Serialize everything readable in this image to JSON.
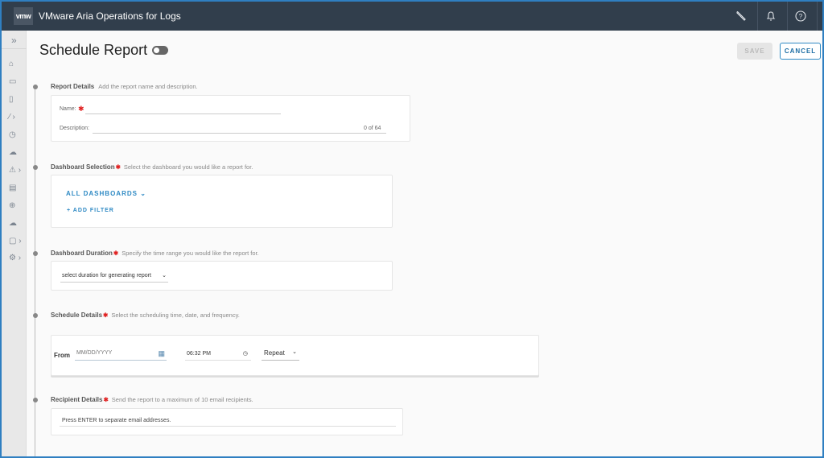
{
  "header": {
    "logo": "vmw",
    "title": "VMware Aria Operations for Logs",
    "icons": [
      "wrench-icon",
      "bell-icon",
      "help-icon"
    ]
  },
  "sidebar": {
    "expand": "»",
    "items": [
      "home-icon",
      "dashboards-icon",
      "explore-logs-icon",
      "tools-icon",
      "gauge-icon",
      "cloud-icon",
      "alerts-icon",
      "clipboard-icon",
      "integrations-icon",
      "cloud-sync-icon",
      "reports-icon",
      "settings-icon"
    ]
  },
  "page": {
    "title": "Schedule Report",
    "save": "SAVE",
    "cancel": "CANCEL"
  },
  "report_details": {
    "title": "Report Details",
    "hint": "Add the report name and description.",
    "name_label": "Name:",
    "req": "✱",
    "desc_label": "Description:",
    "counter": "0 of 64"
  },
  "dashboard_selection": {
    "title": "Dashboard Selection",
    "req": "✱",
    "hint": "Select the dashboard you would like a report for.",
    "all": "ALL DASHBOARDS ⌄",
    "add_filter": "+ ADD FILTER"
  },
  "dashboard_duration": {
    "title": "Dashboard Duration",
    "req": "✱",
    "hint": "Specify the time range you would like the report for.",
    "select": "select duration for generating report"
  },
  "schedule_details": {
    "title": "Schedule Details",
    "req": "✱",
    "hint": "Select the scheduling time, date, and frequency.",
    "from": "From",
    "date_placeholder": "MM/DD/YYYY",
    "time": "06:32 PM",
    "repeat": "Repeat"
  },
  "recipient_details": {
    "title": "Recipient Details",
    "req": "✱",
    "hint": "Send the report to a maximum of 10 email recipients.",
    "placeholder": "Press ENTER to separate email addresses."
  }
}
